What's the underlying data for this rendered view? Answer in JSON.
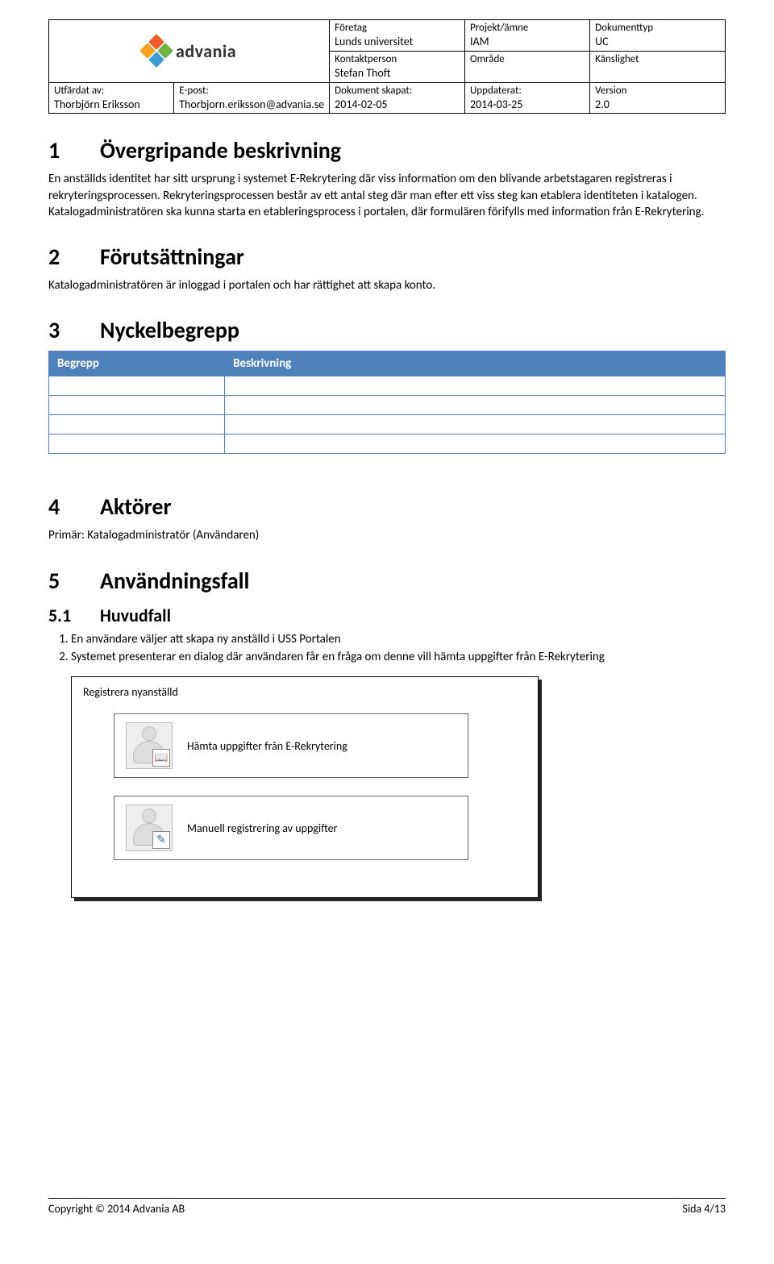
{
  "header": {
    "logo_text": "advania",
    "row1": [
      {
        "label": "Företag",
        "value": "Lunds universitet"
      },
      {
        "label": "Projekt/ämne",
        "value": "IAM"
      },
      {
        "label": "Dokumenttyp",
        "value": "UC"
      }
    ],
    "row2": [
      {
        "label": "Kontaktperson",
        "value": "Stefan Thoft"
      },
      {
        "label": "Område",
        "value": ""
      },
      {
        "label": "Känslighet",
        "value": ""
      }
    ],
    "row3": [
      {
        "label": "Utfärdat av:",
        "value": "Thorbjörn Eriksson"
      },
      {
        "label": "E-post:",
        "value": "Thorbjorn.eriksson@advania.se"
      },
      {
        "label": "Dokument skapat:",
        "value": "2014-02-05"
      },
      {
        "label": "Uppdaterat:",
        "value": "2014-03-25"
      },
      {
        "label": "Version",
        "value": "2.0"
      }
    ]
  },
  "sections": {
    "s1": {
      "num": "1",
      "title": "Övergripande beskrivning",
      "body": "En anställds identitet har sitt ursprung i systemet E-Rekrytering där viss information om den blivande arbetstagaren registreras i rekryteringsprocessen. Rekryteringsprocessen består av ett antal steg där man efter ett viss steg kan etablera identiteten i katalogen. Katalogadministratören ska kunna starta en etableringsprocess i portalen, där formulären förifylls med information från E-Rekrytering."
    },
    "s2": {
      "num": "2",
      "title": "Förutsättningar",
      "body": "Katalogadministratören är inloggad i portalen och har rättighet att skapa konto."
    },
    "s3": {
      "num": "3",
      "title": "Nyckelbegrepp",
      "th1": "Begrepp",
      "th2": "Beskrivning"
    },
    "s4": {
      "num": "4",
      "title": "Aktörer",
      "body": "Primär: Katalogadministratör (Användaren)"
    },
    "s5": {
      "num": "5",
      "title": "Användningsfall"
    },
    "s51": {
      "num": "5.1",
      "title": "Huvudfall",
      "steps": [
        "En användare väljer att skapa ny anställd i USS Portalen",
        "Systemet presenterar en dialog där användaren får en fråga om denne vill hämta uppgifter från E-Rekrytering"
      ]
    }
  },
  "dialog": {
    "title": "Registrera nyanställd",
    "opt1": "Hämta uppgifter från E-Rekrytering",
    "opt2": "Manuell registrering av uppgifter"
  },
  "footer": {
    "left": "Copyright © 2014 Advania AB",
    "right": "Sida 4/13"
  }
}
